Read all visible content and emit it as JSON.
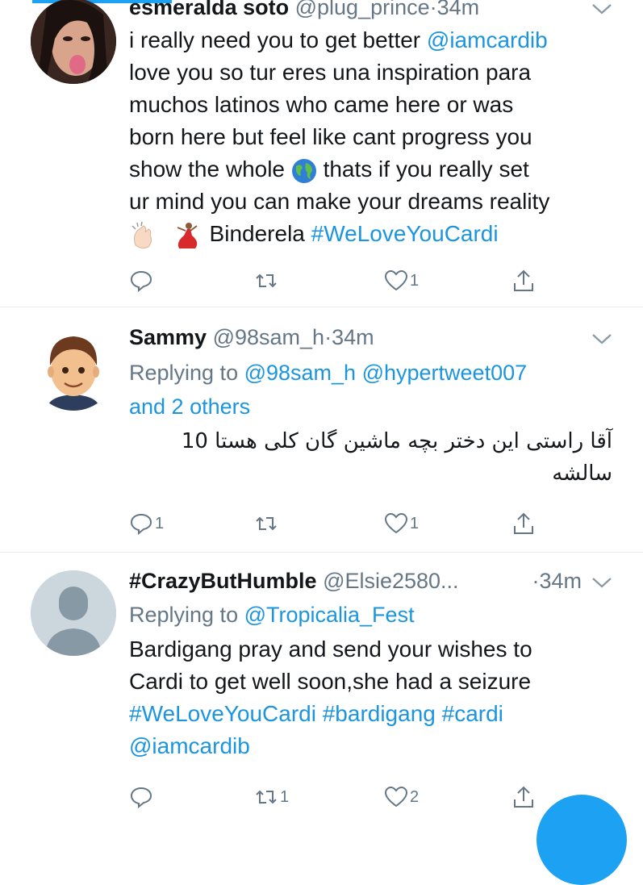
{
  "top_accent": "#1da1f2",
  "tweets": [
    {
      "name": "esmeralda soto",
      "handle": "@plug_prince",
      "dot": "·",
      "time": "34m",
      "body_line1_text": "i really need you to get better ",
      "body_line1_mention": "@iamcardib",
      "body_line2": "love you so tur eres una inspiration para",
      "body_line3": "muchos latinos who came here or was",
      "body_line4": "born here but feel like cant  progress you",
      "body_line5_a": "show the whole ",
      "body_line5_b": " thats if you really set",
      "body_line6": "ur mind you can make your dreams reality",
      "body_line7_text": " Binderela ",
      "body_line7_hashtag": "#WeLoveYouCardi",
      "icons": [
        "globe-icon",
        "clapping-hands-icon",
        "dancer-icon"
      ],
      "reply_count": "",
      "retweet_count": "",
      "like_count": "1"
    },
    {
      "name": "Sammy",
      "handle": "@98sam_h",
      "dot": "·",
      "time": "34m",
      "replying_label": "Replying to ",
      "replying_link1": "@98sam_h",
      "replying_link2": "@hypertweet007",
      "replying_others": "and 2 others",
      "body_line1": "آقا راستی این دختر بچه ماشین گان کلی هستا 10",
      "body_line2": "سالشه",
      "reply_count": "1",
      "retweet_count": "",
      "like_count": "1"
    },
    {
      "name": "#CrazyButHumble",
      "handle": "@Elsie2580...",
      "dot": "·",
      "time": "34m",
      "replying_label": "Replying to ",
      "replying_link1": "@Tropicalia_Fest",
      "body_line1": "Bardigang pray and send your wishes to",
      "body_line2": "Cardi to get well soon,she had a seizure",
      "body_line3": "#WeLoveYouCardi #bardigang #cardi",
      "body_line4": "@iamcardib",
      "reply_count": "",
      "retweet_count": "1",
      "like_count": "2"
    }
  ],
  "colors": {
    "link": "#1b95e0",
    "muted": "#657786",
    "text": "#14171a",
    "divider": "#e6ecf0"
  }
}
